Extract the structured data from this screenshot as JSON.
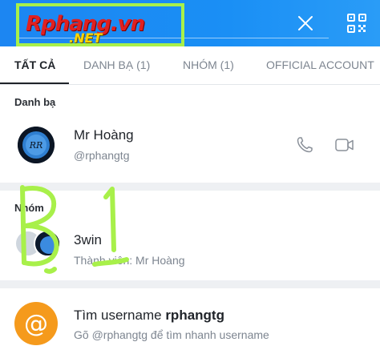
{
  "header": {
    "watermark_top": "Rphang.vn",
    "watermark_bottom": ".NET"
  },
  "tabs": [
    {
      "label": "TẤT CẢ",
      "active": true
    },
    {
      "label": "DANH BẠ (1)",
      "active": false
    },
    {
      "label": "NHÓM (1)",
      "active": false
    },
    {
      "label": "OFFICIAL ACCOUNT",
      "active": false
    }
  ],
  "contacts": {
    "title": "Danh bạ",
    "items": [
      {
        "name": "Mr Hoàng",
        "username": "@rphangtg",
        "avatar_text": "RR"
      }
    ]
  },
  "groups": {
    "title": "Nhóm",
    "items": [
      {
        "name": "3win",
        "members": "Thành viên: Mr Hoàng"
      }
    ]
  },
  "find_username": {
    "prefix": "Tìm username ",
    "query": "rphangtg",
    "hint": "Gõ @rphangtg để tìm nhanh username",
    "icon": "@"
  },
  "colors": {
    "header_blue": "#1c86f2",
    "annotation_green": "#a8f04a",
    "at_orange": "#f59a1c"
  }
}
